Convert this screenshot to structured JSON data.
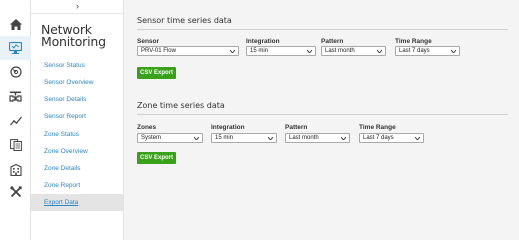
{
  "rail": {
    "items": [
      {
        "icon": "home-icon",
        "active": false
      },
      {
        "icon": "monitor-icon",
        "active": true
      },
      {
        "icon": "gauge-icon",
        "active": false
      },
      {
        "icon": "valve-icon",
        "active": false
      },
      {
        "icon": "trend-icon",
        "active": false
      },
      {
        "icon": "documents-icon",
        "active": false
      },
      {
        "icon": "building-icon",
        "active": false
      },
      {
        "icon": "tools-icon",
        "active": false
      }
    ]
  },
  "subnav": {
    "collapse_glyph": "›",
    "title": "Network Monitoring",
    "items": [
      {
        "label": "Sensor Status"
      },
      {
        "label": "Sensor Overview"
      },
      {
        "label": "Sensor Details"
      },
      {
        "label": "Sensor Report"
      },
      {
        "label": "Zone Status"
      },
      {
        "label": "Zone Overview"
      },
      {
        "label": "Zone Details"
      },
      {
        "label": "Zone Report"
      },
      {
        "label": "Export Data"
      }
    ],
    "active_item": "Export Data"
  },
  "sensor_section": {
    "title": "Sensor time series data",
    "fields": [
      {
        "label": "Sensor",
        "value": "PRV-01 Flow"
      },
      {
        "label": "Integration",
        "value": "15 min"
      },
      {
        "label": "Pattern",
        "value": "Last month"
      },
      {
        "label": "Time Range",
        "value": "Last 7 days"
      }
    ],
    "export_label": "CSV Export"
  },
  "zone_section": {
    "title": "Zone time series data",
    "fields": [
      {
        "label": "Zones",
        "value": "System"
      },
      {
        "label": "Integration",
        "value": "15 min"
      },
      {
        "label": "Pattern",
        "value": "Last month"
      },
      {
        "label": "Time Range",
        "value": "Last 7 days"
      }
    ],
    "export_label": "CSV Export"
  },
  "colors": {
    "accent_link": "#2a86c7",
    "button_green": "#3aa11a",
    "rail_icon": "#444444",
    "active_rail_icon": "#2a86c7"
  }
}
